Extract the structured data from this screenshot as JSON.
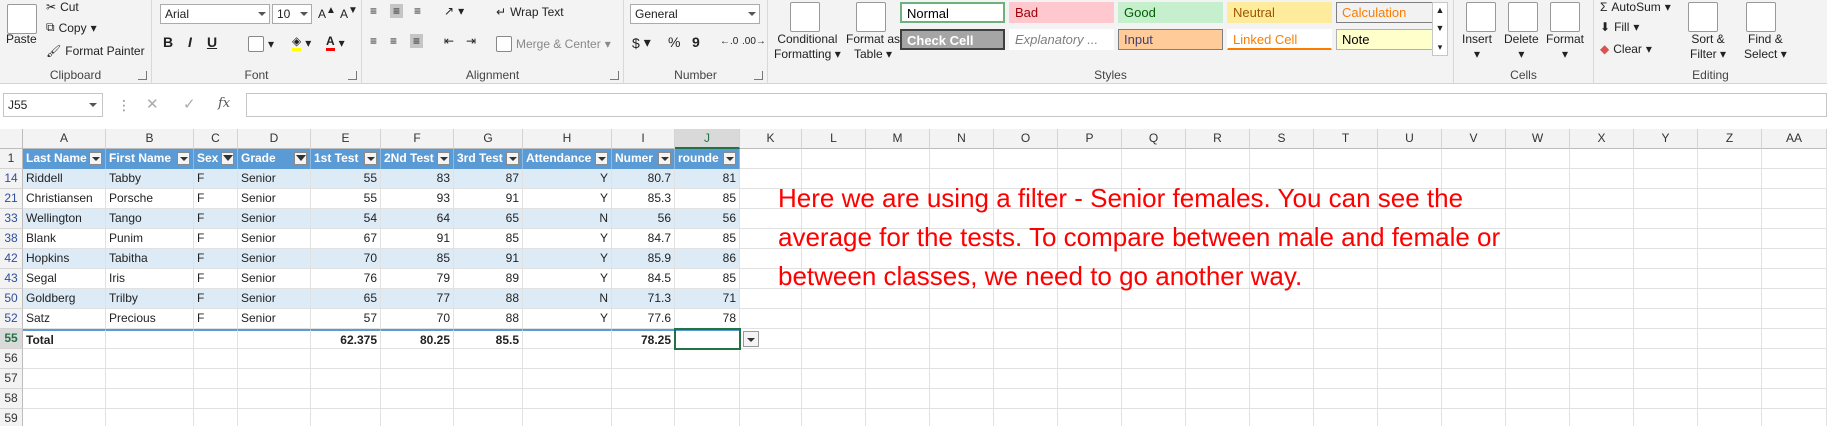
{
  "ribbon": {
    "clipboard": {
      "label": "Clipboard",
      "paste": "Paste",
      "cut": "Cut",
      "copy": "Copy",
      "format_painter": "Format Painter"
    },
    "font": {
      "label": "Font",
      "name": "Arial",
      "size": "10",
      "bold": "B",
      "italic": "I",
      "underline": "U"
    },
    "alignment": {
      "label": "Alignment",
      "wrap_text": "Wrap Text",
      "merge_center": "Merge & Center"
    },
    "number": {
      "label": "Number",
      "format": "General",
      "currency": "$",
      "percent": "%",
      "comma": "9"
    },
    "styles": {
      "label": "Styles",
      "conditional_formatting": [
        "Conditional",
        "Formatting"
      ],
      "format_as_table": [
        "Format as",
        "Table"
      ],
      "cells": [
        {
          "name": "Normal",
          "bg": "#ffffff",
          "fg": "#000000",
          "border": "#6fb07f"
        },
        {
          "name": "Bad",
          "bg": "#ffc7ce",
          "fg": "#9c0006",
          "border": "#ffc7ce"
        },
        {
          "name": "Good",
          "bg": "#c6efce",
          "fg": "#006100",
          "border": "#c6efce"
        },
        {
          "name": "Neutral",
          "bg": "#ffeb9c",
          "fg": "#9c5700",
          "border": "#ffeb9c"
        },
        {
          "name": "Calculation",
          "bg": "#f2f2f2",
          "fg": "#fa7d00",
          "border": "#7f7f7f"
        },
        {
          "name": "Check Cell",
          "bg": "#a5a5a5",
          "fg": "#ffffff",
          "border": "#3f3f3f"
        },
        {
          "name": "Explanatory ...",
          "bg": "#ffffff",
          "fg": "#7f7f7f",
          "border": "#ffffff"
        },
        {
          "name": "Input",
          "bg": "#ffcc99",
          "fg": "#3f3f76",
          "border": "#7f7f7f"
        },
        {
          "name": "Linked Cell",
          "bg": "#ffffff",
          "fg": "#fa7d00",
          "border": "#ffffff"
        },
        {
          "name": "Note",
          "bg": "#ffffcc",
          "fg": "#000000",
          "border": "#b2b2b2"
        }
      ]
    },
    "cells": {
      "label": "Cells",
      "insert": "Insert",
      "delete": "Delete",
      "format": "Format"
    },
    "editing": {
      "label": "Editing",
      "autosum": "AutoSum",
      "fill": "Fill",
      "clear": "Clear",
      "sort_filter": [
        "Sort &",
        "Filter"
      ],
      "find_select": [
        "Find &",
        "Select"
      ]
    }
  },
  "formula_bar": {
    "name_box": "J55",
    "formula": ""
  },
  "columns": [
    "A",
    "B",
    "C",
    "D",
    "E",
    "F",
    "G",
    "H",
    "I",
    "J",
    "K",
    "L",
    "M",
    "N",
    "O",
    "P",
    "Q",
    "R",
    "S",
    "T",
    "U",
    "V",
    "W",
    "X",
    "Y",
    "Z",
    "AA"
  ],
  "headers": [
    "Last Name",
    "First Name",
    "Sex",
    "Grade",
    "1st Test",
    "2Nd Test",
    "3rd Test",
    "Attendance",
    "Numer",
    "rounde"
  ],
  "rows": [
    {
      "row": "14",
      "cells": [
        "Riddell",
        "Tabby",
        "F",
        "Senior",
        "55",
        "83",
        "87",
        "Y",
        "80.7",
        "81"
      ]
    },
    {
      "row": "21",
      "cells": [
        "Christiansen",
        "Porsche",
        "F",
        "Senior",
        "55",
        "93",
        "91",
        "Y",
        "85.3",
        "85"
      ]
    },
    {
      "row": "33",
      "cells": [
        "Wellington",
        "Tango",
        "F",
        "Senior",
        "54",
        "64",
        "65",
        "N",
        "56",
        "56"
      ]
    },
    {
      "row": "38",
      "cells": [
        "Blank",
        "Punim",
        "F",
        "Senior",
        "67",
        "91",
        "85",
        "Y",
        "84.7",
        "85"
      ]
    },
    {
      "row": "42",
      "cells": [
        "Hopkins",
        "Tabitha",
        "F",
        "Senior",
        "70",
        "85",
        "91",
        "Y",
        "85.9",
        "86"
      ]
    },
    {
      "row": "43",
      "cells": [
        "Segal",
        "Iris",
        "F",
        "Senior",
        "76",
        "79",
        "89",
        "Y",
        "84.5",
        "85"
      ]
    },
    {
      "row": "50",
      "cells": [
        "Goldberg",
        "Trilby",
        "F",
        "Senior",
        "65",
        "77",
        "88",
        "N",
        "71.3",
        "71"
      ]
    },
    {
      "row": "52",
      "cells": [
        "Satz",
        "Precious",
        "F",
        "Senior",
        "57",
        "70",
        "88",
        "Y",
        "77.6",
        "78"
      ]
    }
  ],
  "total_row": {
    "row": "55",
    "cells": [
      "Total",
      "",
      "",
      "",
      "62.375",
      "80.25",
      "85.5",
      "",
      "78.25",
      ""
    ]
  },
  "empty_rows": [
    "56",
    "57",
    "58",
    "59"
  ],
  "header_row_number": "1",
  "note": "Here we are using a filter - Senior females. You can see the average for the tests. To compare between male and female or between classes, we need to go another way."
}
